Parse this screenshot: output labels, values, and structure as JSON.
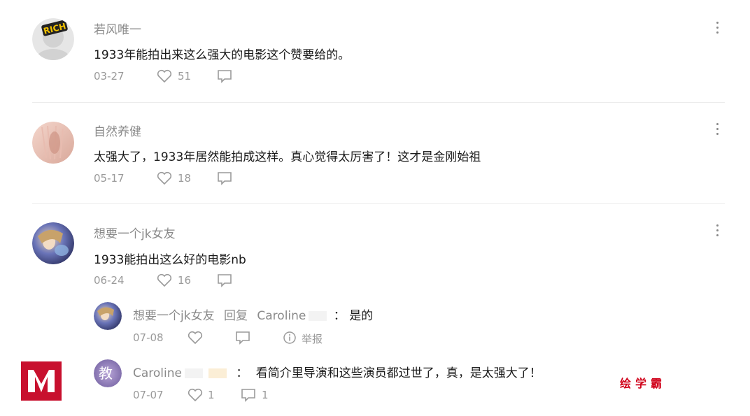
{
  "comments": [
    {
      "username": "若风唯一",
      "avatar_text": "RICH",
      "text": "1933年能拍出来这么强大的电影这个赞要给的。",
      "date": "03-27",
      "likes": "51"
    },
    {
      "username": "自然养健",
      "text": "太强大了，1933年居然能拍成这样。真心觉得太厉害了！这才是金刚始祖",
      "date": "05-17",
      "likes": "18"
    },
    {
      "username": "想要一个jk女友",
      "text": "1933能拍出这么好的电影nb",
      "date": "06-24",
      "likes": "16"
    }
  ],
  "replies": [
    {
      "username": "想要一个jk女友",
      "reply_label": "回复",
      "target": "Caroline",
      "separator": "：",
      "text": "是的",
      "date": "07-08",
      "report": "举报"
    },
    {
      "username": "Caroline",
      "avatar_text": "教",
      "separator": "：",
      "text": "看简介里导演和这些演员都过世了，真，是太强大了！",
      "date": "07-07",
      "likes": "1",
      "replies_count": "1"
    }
  ],
  "watermark": {
    "text": "绘学霸"
  },
  "colors": {
    "username": "#8a8a8a",
    "meta": "#9a9a9a",
    "watermark": "#d0021b"
  }
}
